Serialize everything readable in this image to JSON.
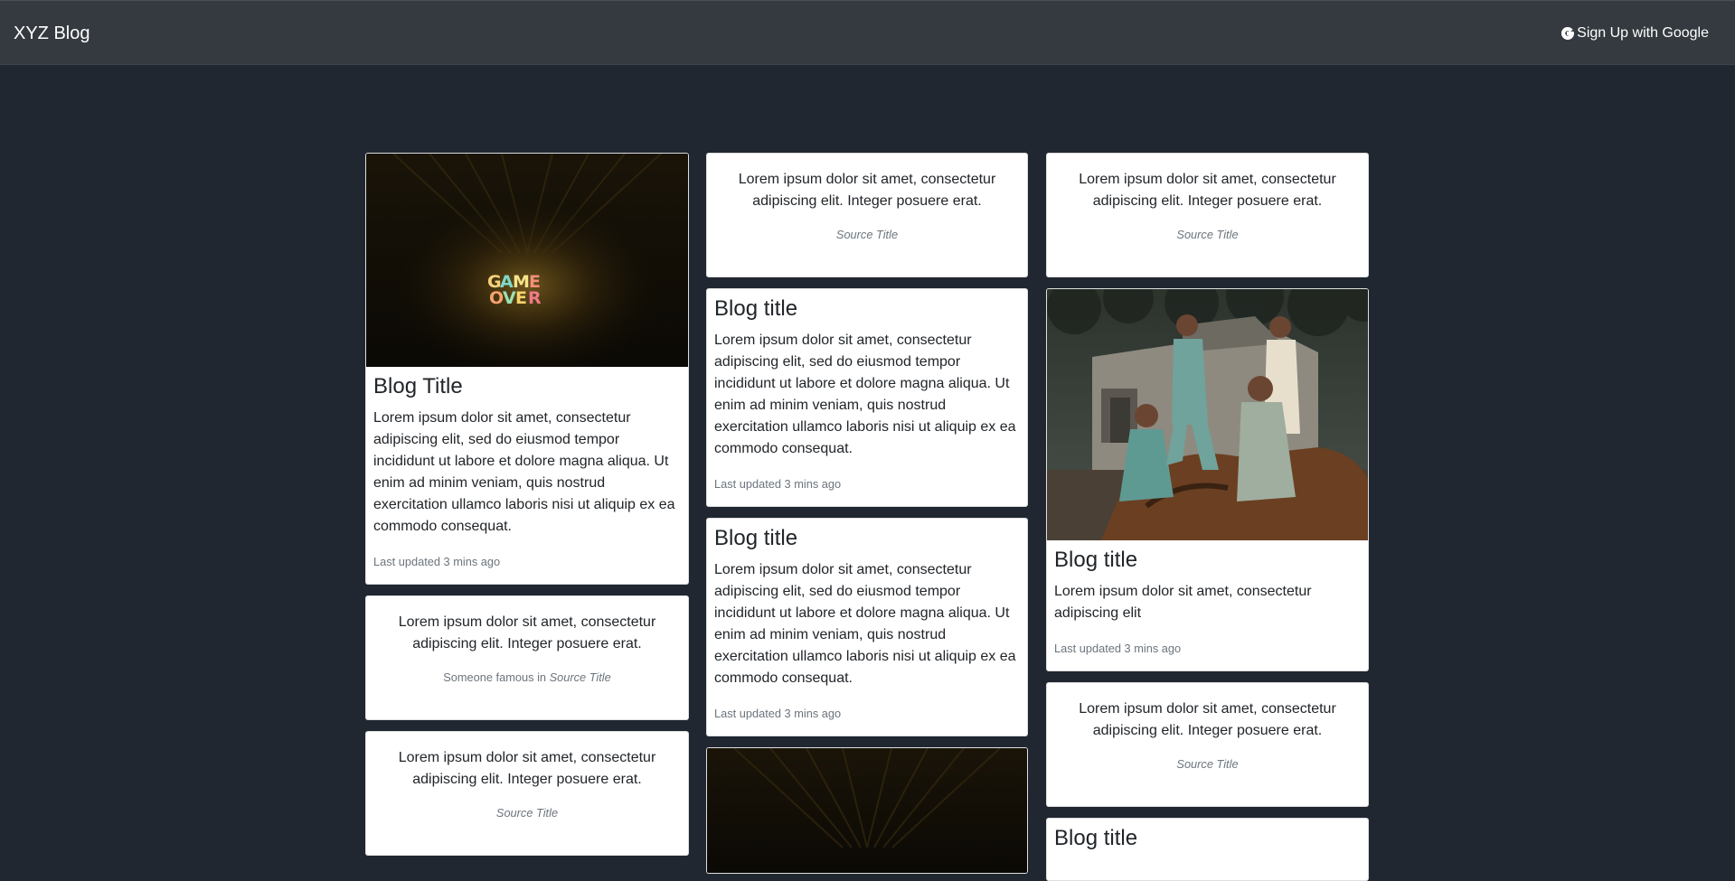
{
  "navbar": {
    "brand": "XYZ Blog",
    "signup_label": "Sign Up with Google",
    "signup_icon": "google-icon"
  },
  "columns": [
    {
      "cards": [
        {
          "type": "image-card",
          "image": "game-over-neon-sign",
          "title": "Blog Title",
          "text": "Lorem ipsum dolor sit amet, consectetur adipiscing elit, sed do eiusmod tempor incididunt ut labore et dolore magna aliqua. Ut enim ad minim veniam, quis nostrud exercitation ullamco laboris nisi ut aliquip ex ea commodo consequat.",
          "meta": "Last updated 3 mins ago"
        },
        {
          "type": "quote-card",
          "quote": "Lorem ipsum dolor sit amet, consectetur adipiscing elit. Integer posuere erat.",
          "footer_prefix": "Someone famous in ",
          "footer_cite": "Source Title"
        },
        {
          "type": "quote-card",
          "quote": "Lorem ipsum dolor sit amet, consectetur adipiscing elit. Integer posuere erat.",
          "footer_prefix": "",
          "footer_cite": "Source Title"
        }
      ]
    },
    {
      "cards": [
        {
          "type": "quote-card",
          "quote": "Lorem ipsum dolor sit amet, consectetur adipiscing elit. Integer posuere erat.",
          "footer_prefix": "",
          "footer_cite": "Source Title"
        },
        {
          "type": "text-card",
          "title": "Blog title",
          "text": "Lorem ipsum dolor sit amet, consectetur adipiscing elit, sed do eiusmod tempor incididunt ut labore et dolore magna aliqua. Ut enim ad minim veniam, quis nostrud exercitation ullamco laboris nisi ut aliquip ex ea commodo consequat.",
          "meta": "Last updated 3 mins ago"
        },
        {
          "type": "text-card",
          "title": "Blog title",
          "text": "Lorem ipsum dolor sit amet, consectetur adipiscing elit, sed do eiusmod tempor incididunt ut labore et dolore magna aliqua. Ut enim ad minim veniam, quis nostrud exercitation ullamco laboris nisi ut aliquip ex ea commodo consequat.",
          "meta": "Last updated 3 mins ago"
        },
        {
          "type": "image-card",
          "image": "game-over-neon-sign",
          "title": "",
          "text": "",
          "meta": ""
        }
      ]
    },
    {
      "cards": [
        {
          "type": "quote-card",
          "quote": "Lorem ipsum dolor sit amet, consectetur adipiscing elit. Integer posuere erat.",
          "footer_prefix": "",
          "footer_cite": "Source Title"
        },
        {
          "type": "image-card",
          "image": "children-photo",
          "title": "Blog title",
          "text": "Lorem ipsum dolor sit amet, consectetur adipiscing elit",
          "meta": "Last updated 3 mins ago"
        },
        {
          "type": "quote-card",
          "quote": "Lorem ipsum dolor sit amet, consectetur adipiscing elit. Integer posuere erat.",
          "footer_prefix": "",
          "footer_cite": "Source Title"
        },
        {
          "type": "text-card",
          "title": "Blog title",
          "text": "",
          "meta": ""
        }
      ]
    }
  ],
  "colors": {
    "page_bg": "#212731",
    "navbar_bg": "#343a40",
    "card_bg": "#ffffff",
    "muted_text": "#6c757d"
  }
}
